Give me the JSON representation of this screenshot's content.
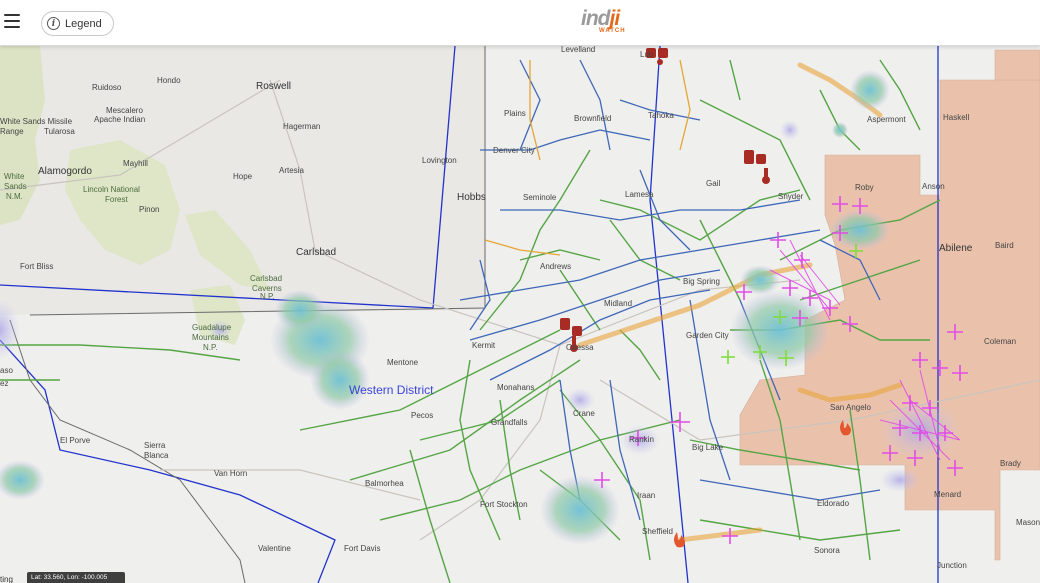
{
  "header": {
    "legend_label": "Legend",
    "logo_main": "ind",
    "logo_accent": "ji",
    "logo_sub": "WATCH"
  },
  "map": {
    "district_label": "Western District",
    "places": {
      "hondo": "Hondo",
      "roswell": "Roswell",
      "ruidoso": "Ruidoso",
      "mescalero": "Mescalero",
      "apache": "Apache Indian",
      "white_sands_missile": "White Sands Missile",
      "range": "Range",
      "tularosa": "Tularosa",
      "hagerman": "Hagerman",
      "lovington": "Lovington",
      "alamogordo": "Alamogordo",
      "mayhill": "Mayhill",
      "white": "White",
      "sands": "Sands",
      "nm": "N.M.",
      "lincoln": "Lincoln National",
      "forest": "Forest",
      "hope": "Hope",
      "artesia": "Artesia",
      "pinon": "Pinon",
      "hobbs": "Hobbs",
      "carlsbad": "Carlsbad",
      "fort_bliss": "Fort Bliss",
      "carlsbad_caverns": "Carlsbad",
      "caverns": "Caverns",
      "caverns_np": "N.P.",
      "guadalupe": "Guadalupe",
      "mountains": "Mountains",
      "guadalupe_np": "N.P.",
      "mentone": "Mentone",
      "pecos": "Pecos",
      "grandfalls": "Grandfalls",
      "el_porvenir": "El Porve",
      "sierra": "Sierra",
      "blanca": "Blanca",
      "van_horn": "Van Horn",
      "balmorhea": "Balmorhea",
      "fort_stockton": "Fort Stockton",
      "fort_davis": "Fort Davis",
      "valentine": "Valentine",
      "levelland": "Levelland",
      "plains": "Plains",
      "brownfield": "Brownfield",
      "tahoka": "Tahoka",
      "denver_city": "Denver City",
      "seminole": "Seminole",
      "gail": "Gail",
      "lamesa": "Lamesa",
      "snyder": "Snyder",
      "andrews": "Andrews",
      "midland": "Midland",
      "big_spring": "Big Spring",
      "odessa": "Odessa",
      "kermit": "Kermit",
      "monahans": "Monahans",
      "garden_city": "Garden City",
      "crane": "Crane",
      "big_lake": "Big Lake",
      "iraan": "Iraan",
      "sheffield": "Sheffield",
      "eldorado": "Eldorado",
      "sonora": "Sonora",
      "junction": "Junction",
      "menard": "Menard",
      "brady": "Brady",
      "mason": "Mason",
      "coleman": "Coleman",
      "abilene": "Abilene",
      "baird": "Baird",
      "anson": "Anson",
      "haskell": "Haskell",
      "aspermont": "Aspermont",
      "roby": "Roby",
      "san_angelo": "San Angelo",
      "lubbock": "Lub",
      "rankin": "Rankin",
      "el_paso_edge": "aso",
      "lopez_edge": "ez"
    }
  },
  "status": {
    "coordinates": "Lat: 33.560, Lon: -100.005",
    "edge_text": "ting"
  },
  "colors": {
    "pipeline_green": "#55a545",
    "pipeline_blue": "#3f67b8",
    "boundary_blue": "#2233cc",
    "county_fill": "#e9b497",
    "lightning_magenta": "#e14ce6",
    "lightning_green": "#7fdc3a",
    "storm_highlight": "#e8a43a"
  },
  "icons": {
    "menu": "hamburger-icon",
    "legend": "info-icon",
    "fire": "fire-icon",
    "thermometer": "thermometer-alert-icon"
  }
}
